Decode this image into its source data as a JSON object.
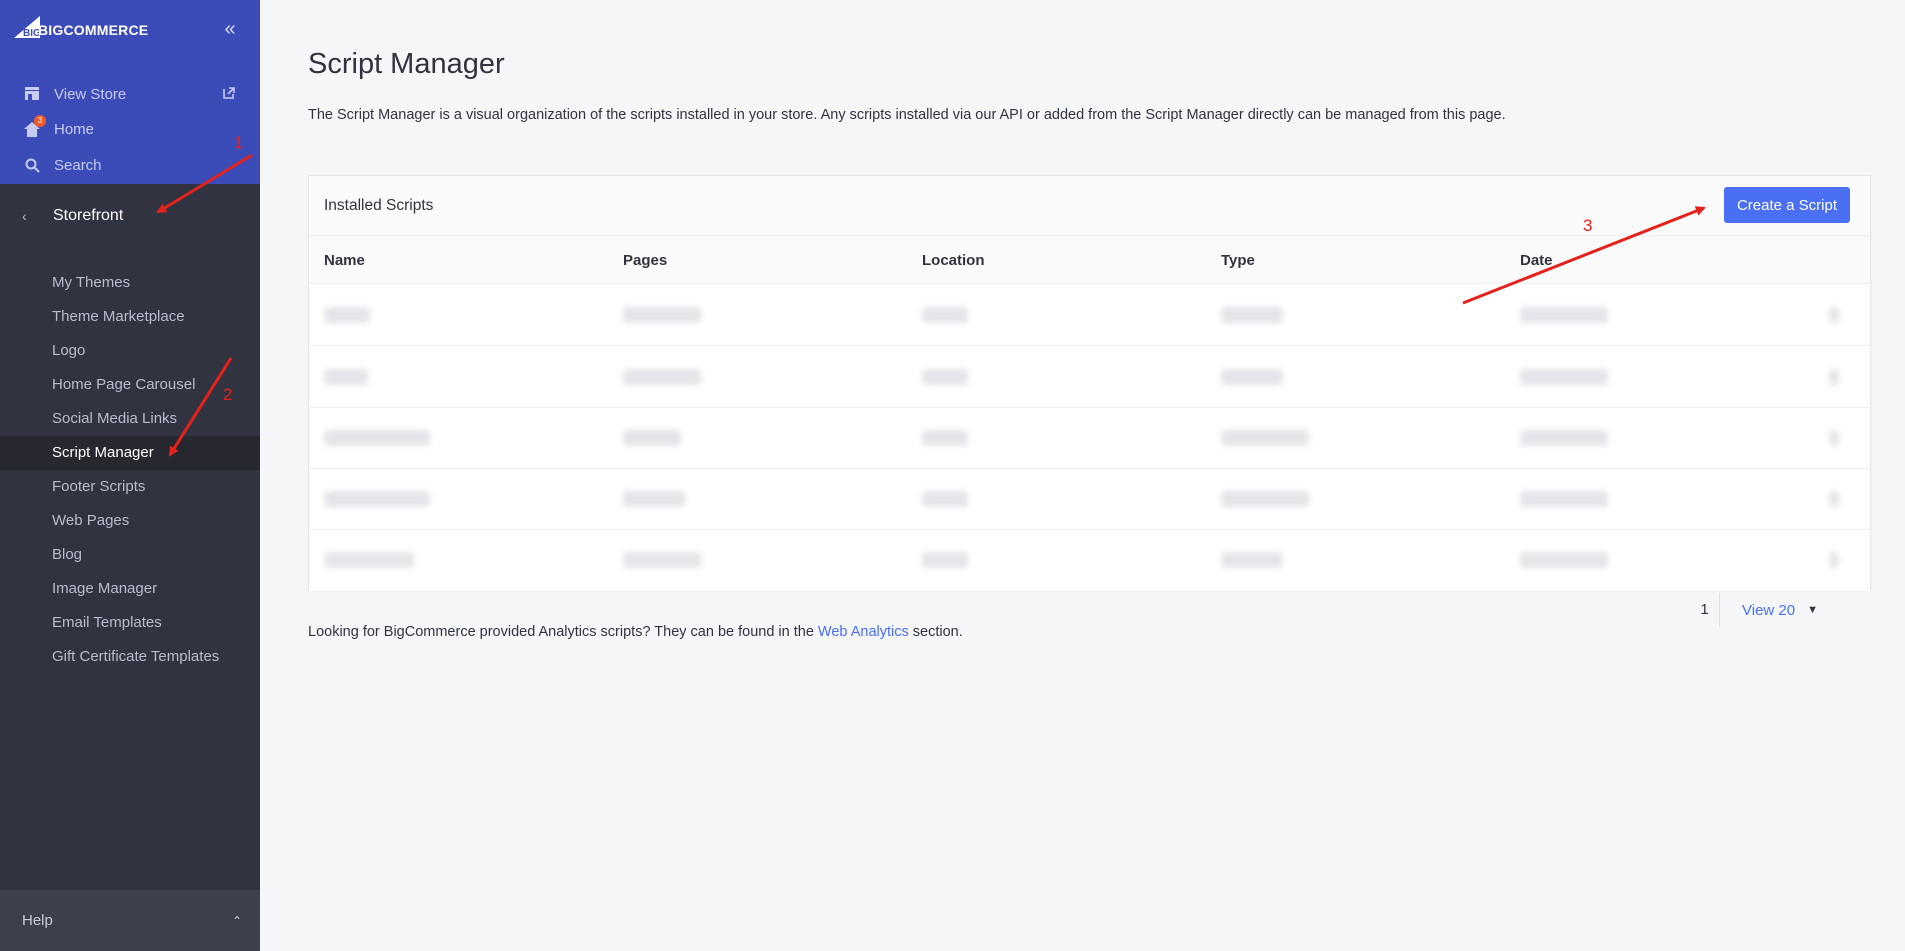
{
  "brand": {
    "name": "BIGCOMMERCE"
  },
  "sidebar": {
    "top_items": [
      {
        "label": "View Store",
        "icon": "store-icon",
        "external_icon": "external-link-icon"
      },
      {
        "label": "Home",
        "icon": "home-icon",
        "badge": "3"
      },
      {
        "label": "Search",
        "icon": "search-icon"
      }
    ],
    "section": {
      "label": "Storefront",
      "icon": "chevron-left-icon"
    },
    "items": [
      {
        "label": "My Themes"
      },
      {
        "label": "Theme Marketplace"
      },
      {
        "label": "Logo"
      },
      {
        "label": "Home Page Carousel"
      },
      {
        "label": "Social Media Links"
      },
      {
        "label": "Script Manager",
        "active": true
      },
      {
        "label": "Footer Scripts"
      },
      {
        "label": "Web Pages"
      },
      {
        "label": "Blog"
      },
      {
        "label": "Image Manager"
      },
      {
        "label": "Email Templates"
      },
      {
        "label": "Gift Certificate Templates"
      }
    ],
    "help_label": "Help"
  },
  "main": {
    "title": "Script Manager",
    "description": "The Script Manager is a visual organization of the scripts installed in your store. Any scripts installed via our API or added from the Script Manager directly can be managed from this page.",
    "panel": {
      "title": "Installed Scripts",
      "create_button": "Create a Script",
      "columns": [
        "Name",
        "Pages",
        "Location",
        "Type",
        "Date"
      ],
      "row_count": 5
    },
    "pager": {
      "page": "1",
      "view": "View 20"
    },
    "footnote": {
      "prefix": "Looking for BigCommerce provided Analytics scripts? They can be found in the ",
      "link": "Web Analytics",
      "suffix": " section."
    }
  },
  "annotations": {
    "labels": [
      "1",
      "2",
      "3"
    ],
    "color": "#e5211b"
  },
  "colors": {
    "sidebar_top": "#3b4cb8",
    "sidebar": "#313440",
    "accent": "#4a6ff3"
  }
}
